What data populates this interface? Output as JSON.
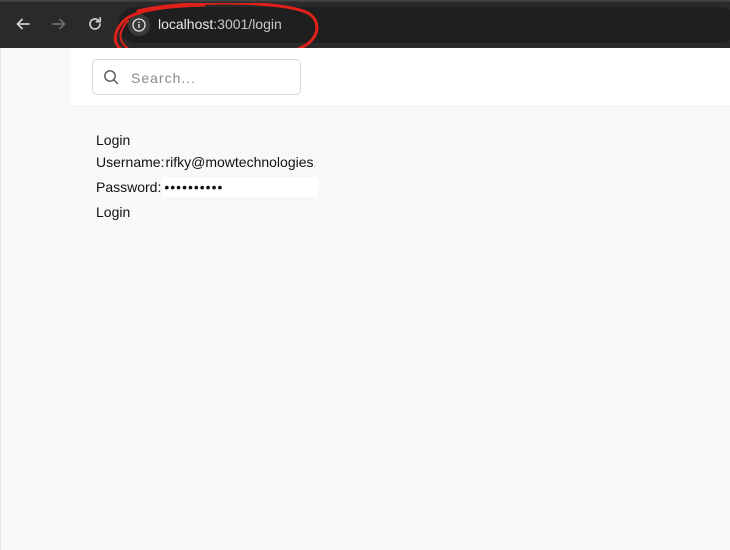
{
  "browser": {
    "url_host": "localhost",
    "url_path": ":3001/login",
    "back_icon": "arrow-left-icon",
    "forward_icon": "arrow-right-icon",
    "reload_icon": "reload-icon",
    "site_info_icon": "info-icon",
    "annotation_color": "#e0201b"
  },
  "header": {
    "search": {
      "placeholder": "Search...",
      "icon": "search-icon"
    }
  },
  "form": {
    "title": "Login",
    "username_label": "Username:",
    "username_value": "rifky@mowtechnologies.",
    "password_label": "Password:",
    "password_value": "••••••••••",
    "submit_label": "Login"
  }
}
